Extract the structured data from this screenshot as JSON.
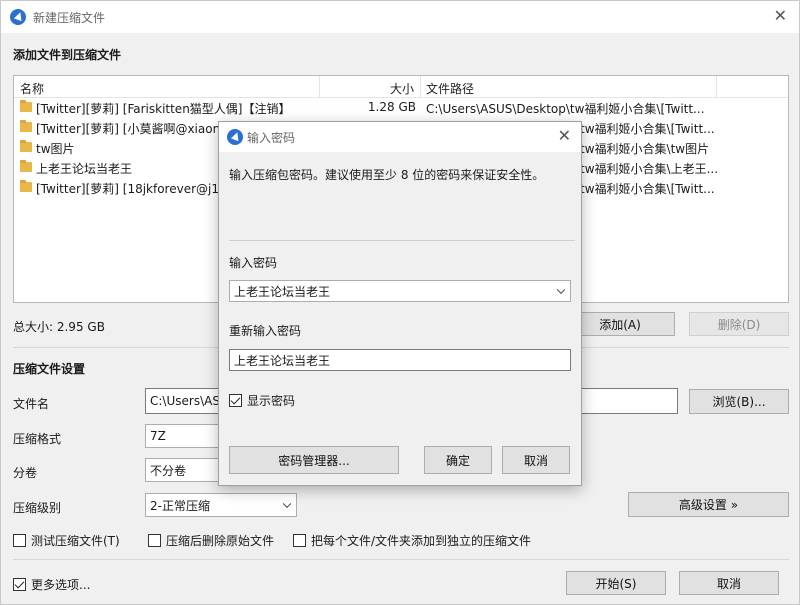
{
  "window": {
    "title": "新建压缩文件"
  },
  "add_section": {
    "title": "添加文件到压缩文件"
  },
  "file_list": {
    "headers": {
      "name": "名称",
      "size": "大小",
      "path": "文件路径"
    },
    "rows": [
      {
        "name": "[Twitter][萝莉] [Fariskitten猫型人偶]【注销】",
        "size": "1.28 GB",
        "path": "C:\\Users\\ASUS\\Desktop\\tw福利姬小合集\\[Twitt..."
      },
      {
        "name": "[Twitter][萝莉] [小莫酱啊@xiaom",
        "size": "",
        "path": "tw福利姬小合集\\[Twitt..."
      },
      {
        "name": "tw图片",
        "size": "",
        "path": "tw福利姬小合集\\tw图片"
      },
      {
        "name": "上老王论坛当老王",
        "size": "",
        "path": "tw福利姬小合集\\上老王..."
      },
      {
        "name": "[Twitter][萝莉] [18jkforever@j1",
        "size": "",
        "path": "tw福利姬小合集\\[Twitt..."
      }
    ]
  },
  "total_size": "总大小: 2.95 GB",
  "buttons": {
    "add": "添加(A)",
    "remove": "删除(D)",
    "browse": "浏览(B)...",
    "advanced": "高级设置 »",
    "start": "开始(S)",
    "cancel": "取消"
  },
  "settings": {
    "title": "压缩文件设置",
    "filename_label": "文件名",
    "filename_value": "C:\\Users\\AS",
    "format_label": "压缩格式",
    "format_value": "7Z",
    "split_label": "分卷",
    "split_value": "不分卷",
    "level_label": "压缩级别",
    "level_value": "2-正常压缩"
  },
  "options": {
    "test": "测试压缩文件(T)",
    "delete_original": "压缩后删除原始文件",
    "separate": "把每个文件/文件夹添加到独立的压缩文件",
    "more": "更多选项..."
  },
  "dialog": {
    "title": "输入密码",
    "description": "输入压缩包密码。建议使用至少 8 位的密码来保证安全性。",
    "password_label": "输入密码",
    "password_value": "上老王论坛当老王",
    "reenter_label": "重新输入密码",
    "reenter_value": "上老王论坛当老王",
    "show_password": "显示密码",
    "manager_button": "密码管理器...",
    "ok_button": "确定",
    "cancel_button": "取消"
  }
}
